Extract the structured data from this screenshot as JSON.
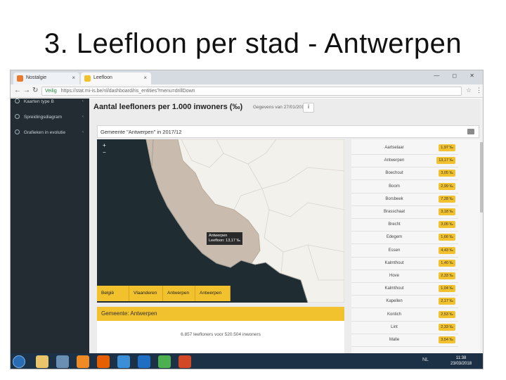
{
  "slide": {
    "title": "3. Leefloon per stad - Antwerpen"
  },
  "browser": {
    "tabs": [
      {
        "label": "Nostalgie",
        "favicon_color": "#e8792f"
      },
      {
        "label": "Leefloon",
        "favicon_color": "#f2c12e"
      }
    ],
    "window_controls": "— ◻ ✕",
    "secure_label": "Veilig",
    "url": "https://stat.mi-is.be/nl/dashboard/ris_entities?menu=drillDown"
  },
  "sidebar": {
    "items": [
      {
        "label": "Kaarten type B",
        "chevron": "‹"
      },
      {
        "label": "Spreidingsdiagram",
        "chevron": "‹"
      },
      {
        "label": "Grafieken in evolutie",
        "chevron": "‹"
      }
    ]
  },
  "header": {
    "title": "Aantal leefloners per 1.000 inwoners (‰)",
    "date": "Gegevens van 27/01/2016",
    "info_icon": "i"
  },
  "municipality_header": "Gemeente \"Antwerpen\" in 2017/12",
  "map": {
    "zoom_in": "+",
    "zoom_out": "−",
    "tooltip_name": "Antwerpen",
    "tooltip_value": "Leefloon: 13,17 ‰"
  },
  "breadcrumbs": [
    "België",
    "Vlaanderen",
    "Antwerpen",
    "Antwerpen"
  ],
  "detail": {
    "title": "Gemeente: Antwerpen",
    "summary": "6.857 leefloners voor 520.504 inwoners"
  },
  "ranking": [
    {
      "name": "Aartselaar",
      "value": "1,97 ‰"
    },
    {
      "name": "Antwerpen",
      "value": "13,17 ‰"
    },
    {
      "name": "Boechout",
      "value": "3,05 ‰"
    },
    {
      "name": "Boom",
      "value": "2,99 ‰"
    },
    {
      "name": "Borsbeek",
      "value": "7,28 ‰"
    },
    {
      "name": "Brasschaat",
      "value": "3,18 ‰"
    },
    {
      "name": "Brecht",
      "value": "3,05 ‰"
    },
    {
      "name": "Edegem",
      "value": "1,66 ‰"
    },
    {
      "name": "Essen",
      "value": "4,43 ‰"
    },
    {
      "name": "Kalmthout",
      "value": "1,40 ‰"
    },
    {
      "name": "Hove",
      "value": "2,33 ‰"
    },
    {
      "name": "Kalmthout",
      "value": "1,04 ‰"
    },
    {
      "name": "Kapellen",
      "value": "2,17 ‰"
    },
    {
      "name": "Kontich",
      "value": "2,53 ‰"
    },
    {
      "name": "Lint",
      "value": "2,33 ‰"
    },
    {
      "name": "Malle",
      "value": "3,54 ‰"
    }
  ],
  "taskbar": {
    "icons": [
      {
        "name": "explorer",
        "color": "#e9c46a"
      },
      {
        "name": "user-app",
        "color": "#6b8fb3"
      },
      {
        "name": "media-player",
        "color": "#f08a24"
      },
      {
        "name": "firefox",
        "color": "#e66000"
      },
      {
        "name": "internet-explorer",
        "color": "#3b8fd6"
      },
      {
        "name": "outlook",
        "color": "#1e6fc4"
      },
      {
        "name": "chrome",
        "color": "#4caf50"
      },
      {
        "name": "powerpoint",
        "color": "#d24726"
      }
    ],
    "tray_lang": "NL",
    "time": "11:38",
    "date": "23/03/2018"
  },
  "colors": {
    "accent_yellow": "#f2c12e",
    "sidebar_bg": "#222c32",
    "map_bg": "#1f2d33",
    "region_fill": "#c9bcae",
    "land_fill": "#f3f1ec"
  }
}
